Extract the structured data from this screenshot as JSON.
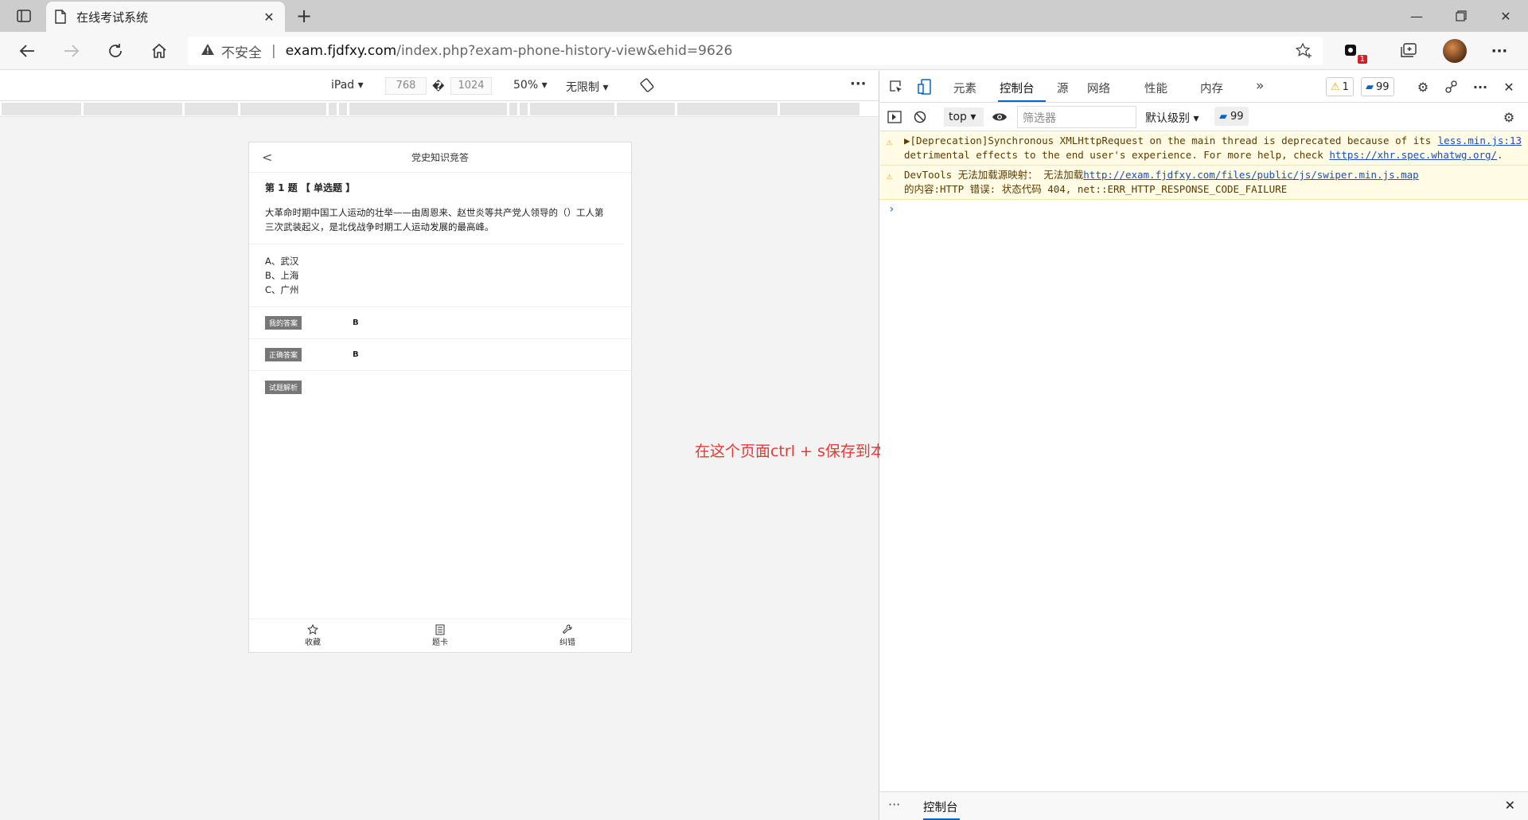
{
  "browser": {
    "tab_title": "在线考试系统",
    "address": {
      "insecure_label": "不安全",
      "host": "exam.fjdfxy.com",
      "path": "/index.php?exam-phone-history-view&ehid=9626"
    },
    "extension_badge": "1"
  },
  "emulation": {
    "device": "iPad",
    "width": "768",
    "times": "�",
    "height": "1024",
    "zoom": "50%",
    "throttle": "无限制",
    "more": "···"
  },
  "exam": {
    "header_title": "党史知识竞答",
    "back_glyph": "<",
    "question_number": "第 1 题 【 单选题 】",
    "question_text": "大革命时期中国工人运动的壮举——由周恩来、赵世炎等共产党人领导的（）工人第三次武装起义，是北伐战争时期工人运动发展的最高峰。",
    "options": [
      "A、武汉",
      "B、上海",
      "C、广州"
    ],
    "my_answer_label": "我的答案",
    "my_answer": "B",
    "correct_answer_label": "正确答案",
    "correct_answer": "B",
    "analysis_label": "试题解析",
    "footer": {
      "favorite": "收藏",
      "card": "题卡",
      "report": "纠错"
    }
  },
  "annotation": "在这个页面ctrl + s保存到本地",
  "devtools": {
    "tabs": [
      "元素",
      "控制台",
      "源",
      "网络",
      "性能",
      "内存"
    ],
    "warning_count": "1",
    "message_count": "99",
    "context": "top",
    "filter_placeholder": "筛选器",
    "level": "默认级别",
    "messages_pill": "99",
    "logs": [
      {
        "text": "▶[Deprecation]Synchronous XMLHttpRequest on the main thread is deprecated because of its detrimental effects to the end user's experience. For more help, check ",
        "link": "https://xhr.spec.whatwg.org/",
        "tail": ".",
        "source": "less.min.js:13"
      },
      {
        "text": "DevTools 无法加载源映射： 无法加载",
        "link": "http://exam.fjdfxy.com/files/public/js/swiper.min.js.map",
        "tail": "的内容:HTTP 错误: 状态代码 404, net::ERR_HTTP_RESPONSE_CODE_FAILURE",
        "source": ""
      }
    ],
    "prompt": "›",
    "drawer_tab": "控制台"
  },
  "colors": {
    "accent": "#0a64c8",
    "annotation": "#e53935",
    "warning_bg": "#fffbe5"
  }
}
